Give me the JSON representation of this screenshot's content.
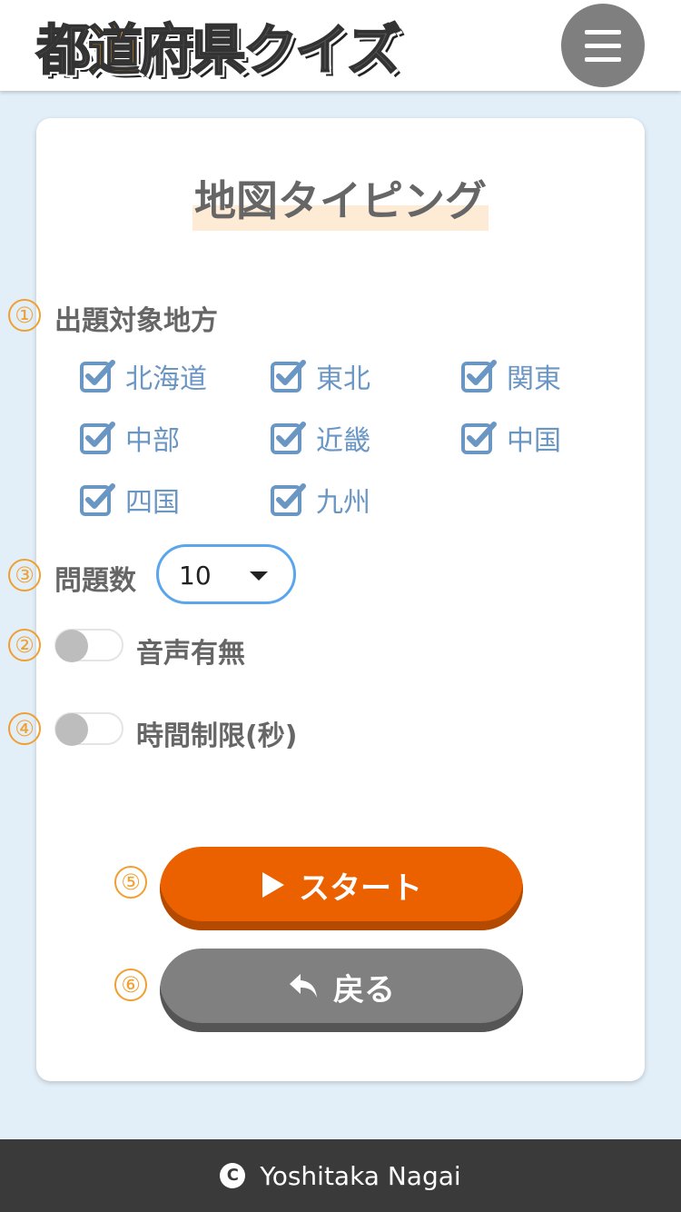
{
  "header": {
    "logo": [
      "都",
      "道",
      "府",
      "県",
      "ク",
      "イ",
      "ズ"
    ],
    "logo_accent_index": 1,
    "menu_icon": "hamburger-icon"
  },
  "page": {
    "title": "地図タイピング"
  },
  "section_numbers": [
    "①",
    "②",
    "③",
    "④",
    "⑤",
    "⑥"
  ],
  "regions": {
    "label": "出題対象地方",
    "items": [
      {
        "label": "北海道",
        "checked": true
      },
      {
        "label": "東北",
        "checked": true
      },
      {
        "label": "関東",
        "checked": true
      },
      {
        "label": "中部",
        "checked": true
      },
      {
        "label": "近畿",
        "checked": true
      },
      {
        "label": "中国",
        "checked": true
      },
      {
        "label": "四国",
        "checked": true
      },
      {
        "label": "九州",
        "checked": true
      }
    ]
  },
  "question_count": {
    "label": "問題数",
    "value": "10"
  },
  "voice": {
    "label": "音声有無",
    "enabled": false
  },
  "time_limit": {
    "label": "時間制限(秒)",
    "enabled": false
  },
  "buttons": {
    "start": "スタート",
    "back": "戻る"
  },
  "footer": {
    "copyright_symbol": "C",
    "author": "Yoshitaka Nagai"
  },
  "colors": {
    "accent_orange": "#eb6100",
    "number_orange": "#f0a030",
    "checkbox_blue": "#6a96c4",
    "select_border": "#5aa6ee",
    "background": "#e2eef8",
    "footer_bg": "#3a3a3a"
  }
}
